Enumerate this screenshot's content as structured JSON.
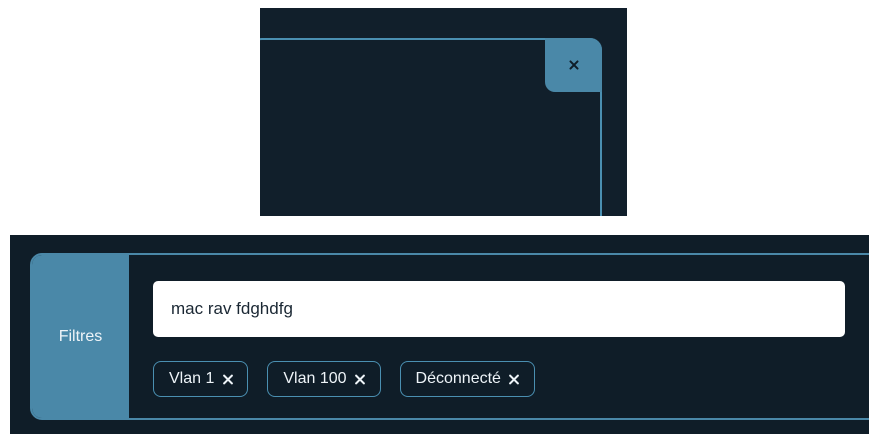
{
  "modal": {
    "close_icon": "close-icon"
  },
  "filters": {
    "label": "Filtres",
    "search_value": "mac rav fdghdfg",
    "tags": [
      {
        "label": "Vlan 1",
        "icon": "close-icon"
      },
      {
        "label": "Vlan 100",
        "icon": "close-icon"
      },
      {
        "label": "Déconnecté",
        "icon": "close-icon"
      }
    ]
  },
  "colors": {
    "background": "#0f1d28",
    "accent": "#4a88a8",
    "text": "#eef4f8"
  }
}
